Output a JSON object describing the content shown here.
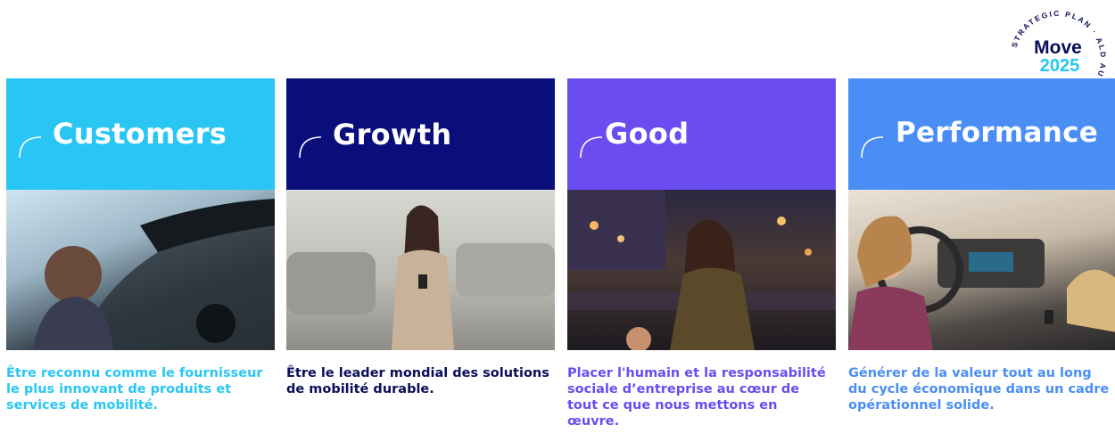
{
  "badge": {
    "ring_text": "STRATEGIC PLAN · ALD AUTOMOTIVE ·",
    "word": "Move",
    "year": "2025",
    "colors": {
      "word": "#0a0e5a",
      "year": "#26c6f3"
    }
  },
  "cards": [
    {
      "title": "Customers",
      "caption": "Être reconnu comme le fournisseur le plus innovant de produits et services de mobilité.",
      "color": "#29c6f4",
      "photo": "woman-convertible-car"
    },
    {
      "title": "Growth",
      "caption": "Être le leader mondial des solutions de mobilité durable.",
      "color": "#0a0e7a",
      "photo": "woman-phone-parking"
    },
    {
      "title": "Good",
      "caption": "Placer l'humain et la responsabilité sociale d’entreprise au cœur de tout ce que nous mettons en œuvre.",
      "color": "#6b4cf0",
      "photo": "woman-night-city"
    },
    {
      "title": "Performance",
      "caption": "Générer de la valeur tout au long du cycle économique dans un cadre opérationnel solide.",
      "color": "#4a8ef5",
      "photo": "family-driving-car"
    }
  ]
}
